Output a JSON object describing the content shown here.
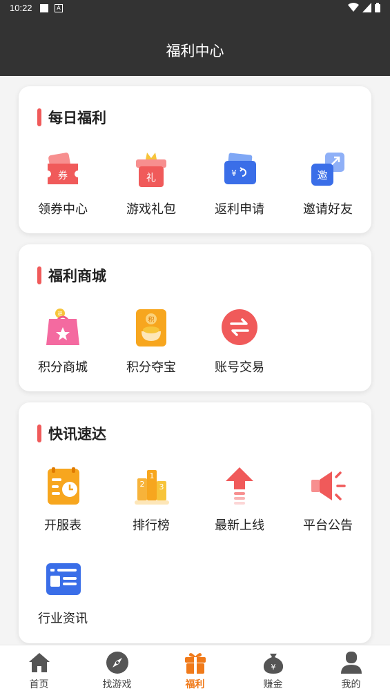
{
  "status_bar": {
    "time": "10:22"
  },
  "header": {
    "title": "福利中心"
  },
  "sections": [
    {
      "title": "每日福利",
      "items": [
        {
          "label": "领券中心",
          "icon": "coupon-icon"
        },
        {
          "label": "游戏礼包",
          "icon": "gift-pack-icon"
        },
        {
          "label": "返利申请",
          "icon": "wallet-rebate-icon"
        },
        {
          "label": "邀请好友",
          "icon": "invite-friend-icon"
        }
      ]
    },
    {
      "title": "福利商城",
      "items": [
        {
          "label": "积分商城",
          "icon": "points-shop-bag-icon"
        },
        {
          "label": "积分夺宝",
          "icon": "points-treasure-icon"
        },
        {
          "label": "账号交易",
          "icon": "account-trade-icon"
        }
      ]
    },
    {
      "title": "快讯速达",
      "items": [
        {
          "label": "开服表",
          "icon": "server-schedule-icon"
        },
        {
          "label": "排行榜",
          "icon": "ranking-podium-icon"
        },
        {
          "label": "最新上线",
          "icon": "new-release-arrow-icon"
        },
        {
          "label": "平台公告",
          "icon": "megaphone-icon"
        },
        {
          "label": "行业资讯",
          "icon": "news-icon"
        }
      ]
    }
  ],
  "icon_text": {
    "coupon": "券",
    "gift": "礼",
    "wallet": "¥",
    "invite": "邀",
    "points": "积",
    "bag_badge": "积",
    "rank": [
      "2",
      "1",
      "3"
    ]
  },
  "tabbar": {
    "active": "福利",
    "tabs": [
      {
        "label": "首页",
        "icon": "home-icon"
      },
      {
        "label": "找游戏",
        "icon": "compass-icon"
      },
      {
        "label": "福利",
        "icon": "gift-icon"
      },
      {
        "label": "赚金",
        "icon": "money-bag-icon"
      },
      {
        "label": "我的",
        "icon": "user-icon"
      }
    ]
  },
  "colors": {
    "header_bg": "#333333",
    "accent_red": "#f05a5a",
    "active_tab": "#f07a1a"
  }
}
